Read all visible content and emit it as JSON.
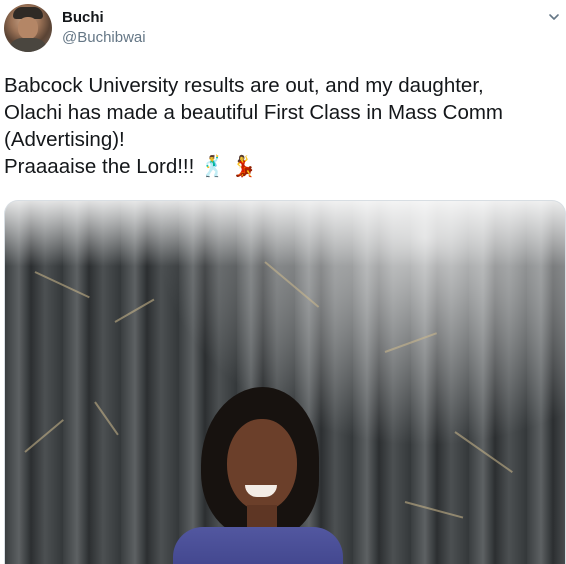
{
  "author": {
    "name": "Buchi",
    "handle": "@Buchibwai"
  },
  "tweet": {
    "text": "Babcock University results are out, and my daughter,\nOlachi has made a beautiful First Class in Mass Comm\n(Advertising)!\nPraaaaise the Lord!!! 🕺 💃"
  },
  "icons": {
    "menu": "chevron-down-icon",
    "avatar": "profile-avatar"
  },
  "colors": {
    "name": "#14171a",
    "handle": "#657786",
    "text": "#14171a",
    "background": "#ffffff"
  }
}
